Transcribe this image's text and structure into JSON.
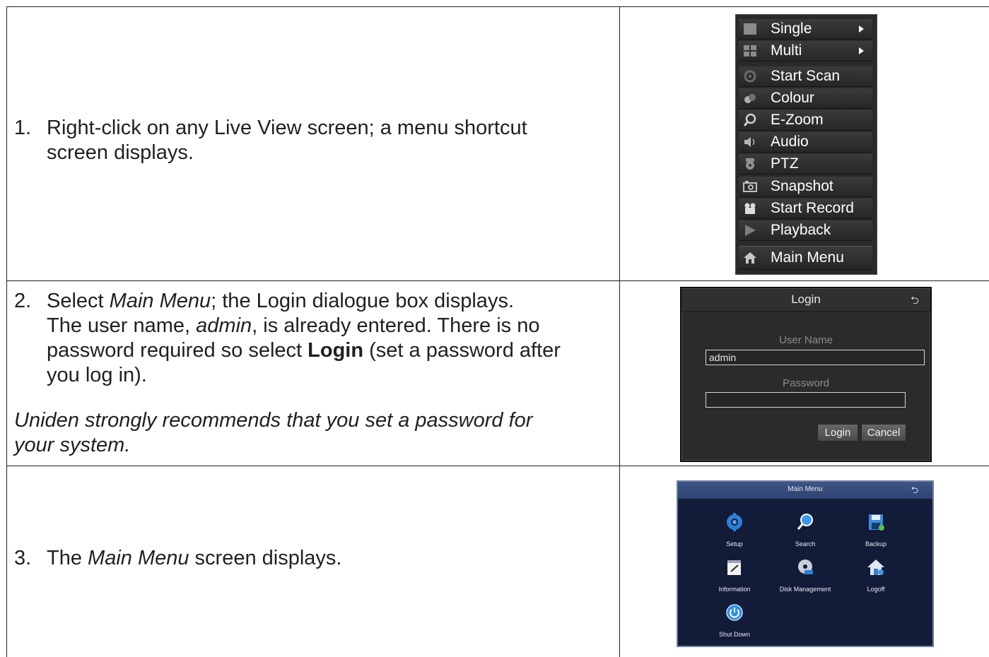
{
  "steps": [
    {
      "number": "1.",
      "lines": [
        "Right-click on any Live View screen; a menu shortcut",
        "screen displays."
      ]
    },
    {
      "number": "2.",
      "line1_pre": "Select ",
      "line1_em": "Main Menu",
      "line1_post": "; the Login dialogue box displays.",
      "line2_pre": "The user name, ",
      "line2_em": "admin",
      "line2_post": ", is already entered. There is no",
      "line3_pre": "password required so select ",
      "line3_strong": "Login",
      "line3_post": " (set a password after",
      "line4": "you log in).",
      "note_lines": [
        "Uniden strongly recommends that you set a password for",
        "your system."
      ]
    },
    {
      "number": "3.",
      "pre": "The ",
      "em": "Main Menu",
      "post": " screen displays."
    }
  ],
  "context_menu": {
    "items": [
      {
        "label": "Single",
        "icon": "single-view-icon",
        "submenu": true
      },
      {
        "label": "Multi",
        "icon": "multi-view-icon",
        "submenu": true
      },
      {
        "label": "Start Scan",
        "icon": "scan-icon",
        "submenu": false
      },
      {
        "label": "Colour",
        "icon": "colour-icon",
        "submenu": false
      },
      {
        "label": "E-Zoom",
        "icon": "zoom-icon",
        "submenu": false
      },
      {
        "label": "Audio",
        "icon": "audio-icon",
        "submenu": false
      },
      {
        "label": "PTZ",
        "icon": "ptz-icon",
        "submenu": false
      },
      {
        "label": "Snapshot",
        "icon": "snapshot-icon",
        "submenu": false
      },
      {
        "label": "Start Record",
        "icon": "record-icon",
        "submenu": false
      },
      {
        "label": "Playback",
        "icon": "playback-icon",
        "submenu": false
      },
      {
        "label": "Main Menu",
        "icon": "home-icon",
        "submenu": false
      }
    ]
  },
  "login_dialog": {
    "title": "Login",
    "user_name_label": "User Name",
    "user_name_value": "admin",
    "password_label": "Password",
    "password_value": "",
    "login_button": "Login",
    "cancel_button": "Cancel"
  },
  "main_menu": {
    "title": "Main Menu",
    "items": [
      {
        "label": "Setup",
        "icon": "setup-gear-icon"
      },
      {
        "label": "Search",
        "icon": "search-icon"
      },
      {
        "label": "Backup",
        "icon": "backup-disk-icon"
      },
      {
        "label": "Information",
        "icon": "information-notepad-icon"
      },
      {
        "label": "Disk Management",
        "icon": "disk-management-icon"
      },
      {
        "label": "Logoff",
        "icon": "logoff-house-icon"
      },
      {
        "label": "Shut Down",
        "icon": "shutdown-power-icon"
      }
    ]
  }
}
